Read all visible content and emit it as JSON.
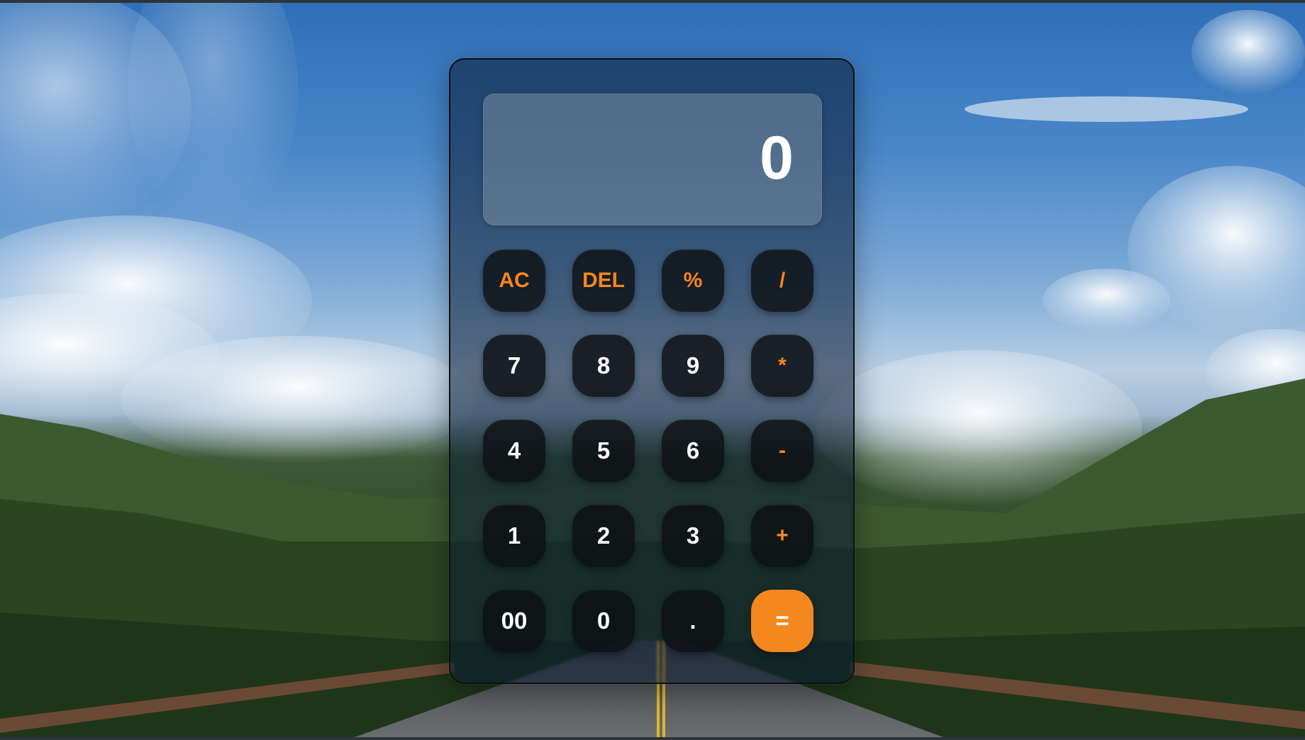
{
  "display": {
    "value": "0"
  },
  "keys": [
    {
      "label": "AC",
      "name": "all-clear-button",
      "kind": "op"
    },
    {
      "label": "DEL",
      "name": "delete-button",
      "kind": "op"
    },
    {
      "label": "%",
      "name": "percent-button",
      "kind": "op"
    },
    {
      "label": "/",
      "name": "divide-button",
      "kind": "op"
    },
    {
      "label": "7",
      "name": "digit-7-button",
      "kind": "num"
    },
    {
      "label": "8",
      "name": "digit-8-button",
      "kind": "num"
    },
    {
      "label": "9",
      "name": "digit-9-button",
      "kind": "num"
    },
    {
      "label": "*",
      "name": "multiply-button",
      "kind": "op"
    },
    {
      "label": "4",
      "name": "digit-4-button",
      "kind": "num"
    },
    {
      "label": "5",
      "name": "digit-5-button",
      "kind": "num"
    },
    {
      "label": "6",
      "name": "digit-6-button",
      "kind": "num"
    },
    {
      "label": "-",
      "name": "subtract-button",
      "kind": "op"
    },
    {
      "label": "1",
      "name": "digit-1-button",
      "kind": "num"
    },
    {
      "label": "2",
      "name": "digit-2-button",
      "kind": "num"
    },
    {
      "label": "3",
      "name": "digit-3-button",
      "kind": "num"
    },
    {
      "label": "+",
      "name": "add-button",
      "kind": "op"
    },
    {
      "label": "00",
      "name": "double-zero-button",
      "kind": "num"
    },
    {
      "label": "0",
      "name": "digit-0-button",
      "kind": "num"
    },
    {
      "label": ".",
      "name": "decimal-button",
      "kind": "num"
    },
    {
      "label": "=",
      "name": "equals-button",
      "kind": "equals"
    }
  ],
  "colors": {
    "accent": "#f5871f",
    "key_background": "#0e1014",
    "key_text": "#ffffff"
  }
}
